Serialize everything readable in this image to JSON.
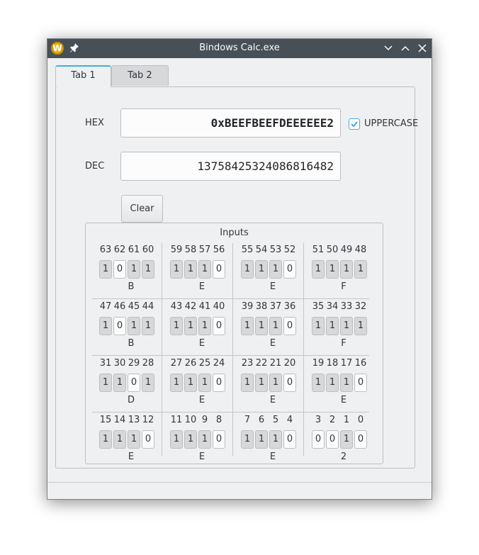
{
  "window": {
    "title": "Bindows Calc.exe"
  },
  "tabs": [
    {
      "label": "Tab 1",
      "active": true
    },
    {
      "label": "Tab 2",
      "active": false
    }
  ],
  "hex": {
    "label": "HEX",
    "value": "0xBEEFBEEFDEEEEEE2"
  },
  "dec": {
    "label": "DEC",
    "value": "13758425324086816482"
  },
  "uppercase": {
    "label": "UPPERCASE",
    "checked": true
  },
  "clear_label": "Clear",
  "inputs": {
    "title": "Inputs",
    "nibbles": [
      {
        "bits": [
          "63",
          "62",
          "61",
          "60"
        ],
        "values": [
          "1",
          "0",
          "1",
          "1"
        ],
        "hex": "B"
      },
      {
        "bits": [
          "59",
          "58",
          "57",
          "56"
        ],
        "values": [
          "1",
          "1",
          "1",
          "0"
        ],
        "hex": "E"
      },
      {
        "bits": [
          "55",
          "54",
          "53",
          "52"
        ],
        "values": [
          "1",
          "1",
          "1",
          "0"
        ],
        "hex": "E"
      },
      {
        "bits": [
          "51",
          "50",
          "49",
          "48"
        ],
        "values": [
          "1",
          "1",
          "1",
          "1"
        ],
        "hex": "F"
      },
      {
        "bits": [
          "47",
          "46",
          "45",
          "44"
        ],
        "values": [
          "1",
          "0",
          "1",
          "1"
        ],
        "hex": "B"
      },
      {
        "bits": [
          "43",
          "42",
          "41",
          "40"
        ],
        "values": [
          "1",
          "1",
          "1",
          "0"
        ],
        "hex": "E"
      },
      {
        "bits": [
          "39",
          "38",
          "37",
          "36"
        ],
        "values": [
          "1",
          "1",
          "1",
          "0"
        ],
        "hex": "E"
      },
      {
        "bits": [
          "35",
          "34",
          "33",
          "32"
        ],
        "values": [
          "1",
          "1",
          "1",
          "1"
        ],
        "hex": "F"
      },
      {
        "bits": [
          "31",
          "30",
          "29",
          "28"
        ],
        "values": [
          "1",
          "1",
          "0",
          "1"
        ],
        "hex": "D"
      },
      {
        "bits": [
          "27",
          "26",
          "25",
          "24"
        ],
        "values": [
          "1",
          "1",
          "1",
          "0"
        ],
        "hex": "E"
      },
      {
        "bits": [
          "23",
          "22",
          "21",
          "20"
        ],
        "values": [
          "1",
          "1",
          "1",
          "0"
        ],
        "hex": "E"
      },
      {
        "bits": [
          "19",
          "18",
          "17",
          "16"
        ],
        "values": [
          "1",
          "1",
          "1",
          "0"
        ],
        "hex": "E"
      },
      {
        "bits": [
          "15",
          "14",
          "13",
          "12"
        ],
        "values": [
          "1",
          "1",
          "1",
          "0"
        ],
        "hex": "E"
      },
      {
        "bits": [
          "11",
          "10",
          "9",
          "8"
        ],
        "values": [
          "1",
          "1",
          "1",
          "0"
        ],
        "hex": "E"
      },
      {
        "bits": [
          "7",
          "6",
          "5",
          "4"
        ],
        "values": [
          "1",
          "1",
          "1",
          "0"
        ],
        "hex": "E"
      },
      {
        "bits": [
          "3",
          "2",
          "1",
          "0"
        ],
        "values": [
          "0",
          "0",
          "1",
          "0"
        ],
        "hex": "2"
      }
    ]
  },
  "colors": {
    "accent": "#3daee9",
    "titlebar": "#475057",
    "bit_on": "#d6d8da",
    "bit_off": "#fcfcfc"
  }
}
